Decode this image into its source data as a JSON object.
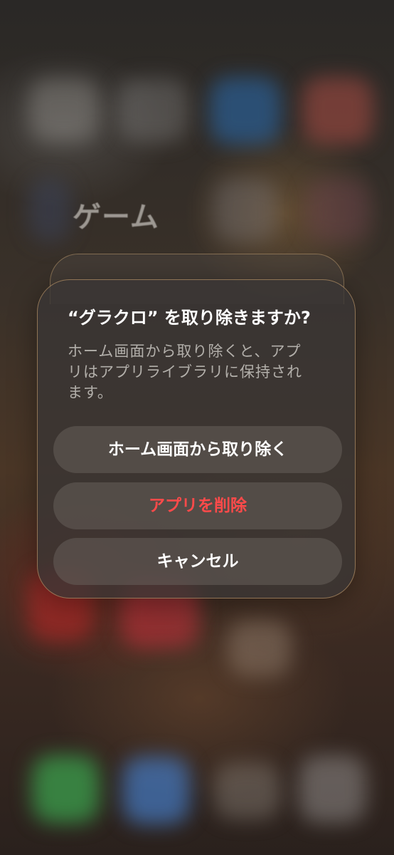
{
  "background": {
    "folder_title": "ゲーム"
  },
  "alert": {
    "title": "“グラクロ” を取り除きますか?",
    "message": "ホーム画面から取り除くと、アプリはアプリライブラリに保持されます。",
    "buttons": {
      "remove_from_home": "ホーム画面から取り除く",
      "delete_app": "アプリを削除",
      "cancel": "キャンセル"
    },
    "colors": {
      "destructive": "#ff4a4a",
      "border": "#d7aa73"
    }
  }
}
